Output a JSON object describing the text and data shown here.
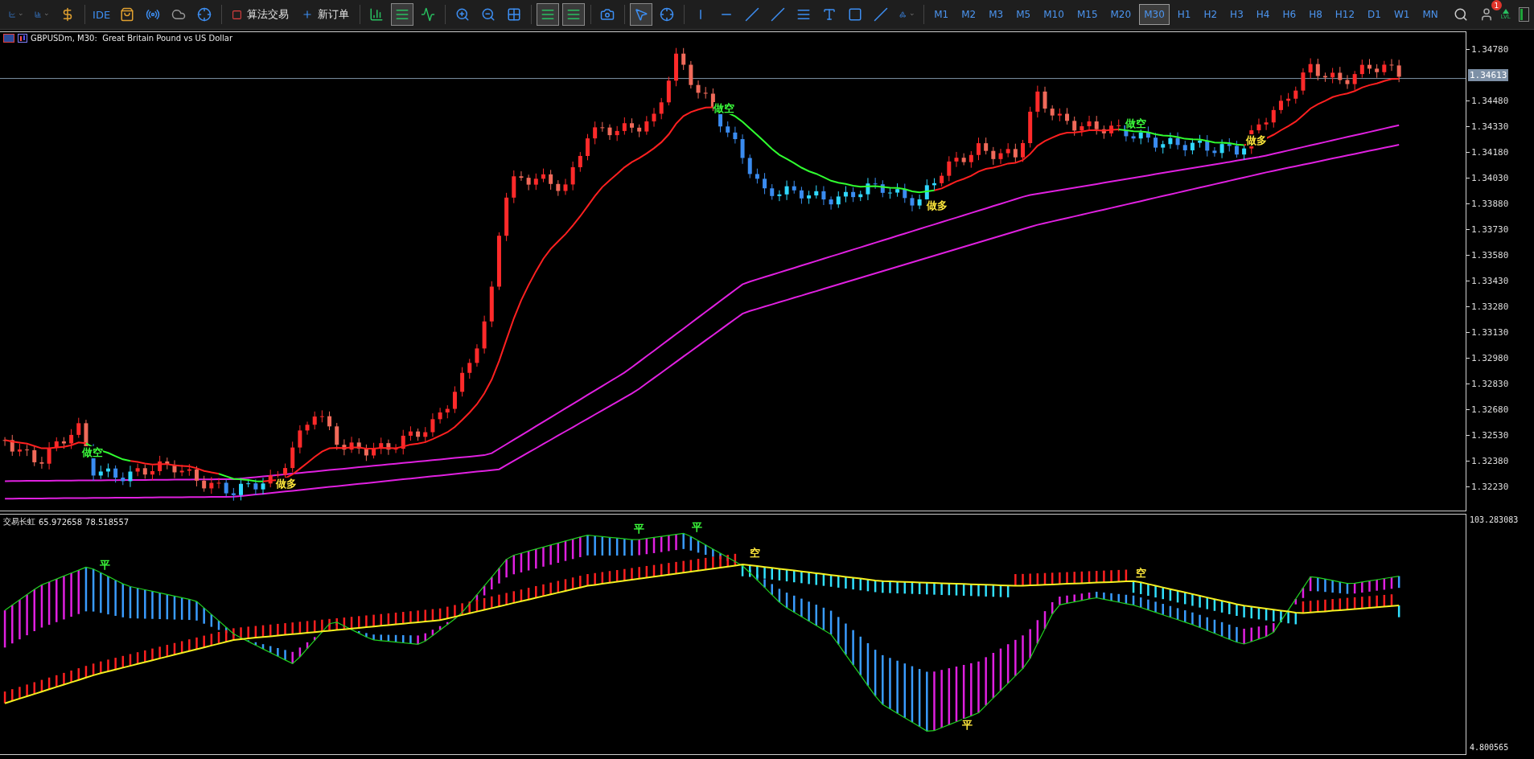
{
  "toolbar": {
    "ide": "IDE",
    "algo_trading": "算法交易",
    "new_order": "新订单",
    "timeframes": [
      {
        "label": "M1",
        "selected": false
      },
      {
        "label": "M2",
        "selected": false
      },
      {
        "label": "M3",
        "selected": false
      },
      {
        "label": "M5",
        "selected": false
      },
      {
        "label": "M10",
        "selected": false
      },
      {
        "label": "M15",
        "selected": false
      },
      {
        "label": "M20",
        "selected": false
      },
      {
        "label": "M30",
        "selected": true
      },
      {
        "label": "H1",
        "selected": false
      },
      {
        "label": "H2",
        "selected": false
      },
      {
        "label": "H3",
        "selected": false
      },
      {
        "label": "H4",
        "selected": false
      },
      {
        "label": "H6",
        "selected": false
      },
      {
        "label": "H8",
        "selected": false
      },
      {
        "label": "H12",
        "selected": false
      },
      {
        "label": "D1",
        "selected": false
      },
      {
        "label": "W1",
        "selected": false
      },
      {
        "label": "MN",
        "selected": false
      }
    ],
    "notification_count": "1",
    "signal_label": "LVL"
  },
  "chart": {
    "title": "GBPUSDm, M30:  Great Britain Pound vs US Dollar",
    "current_price": "1.34613",
    "price_ticks": [
      "1.34780",
      "1.34480",
      "1.34330",
      "1.34180",
      "1.34030",
      "1.33880",
      "1.33730",
      "1.33580",
      "1.33430",
      "1.33280",
      "1.33130",
      "1.32980",
      "1.32830",
      "1.32680",
      "1.32530",
      "1.32380",
      "1.32230"
    ],
    "signals": [
      {
        "text": "做空",
        "color": "#3cff3c"
      },
      {
        "text": "做多",
        "color": "#ffe83c"
      },
      {
        "text": "做空",
        "color": "#3cff3c"
      },
      {
        "text": "做多",
        "color": "#ffe83c"
      },
      {
        "text": "做空",
        "color": "#3cff3c"
      },
      {
        "text": "做多",
        "color": "#ffe83c"
      }
    ]
  },
  "indicator": {
    "name": "交易长虹",
    "values": [
      "65.972658",
      "78.518557"
    ],
    "axis_max": "103.283083",
    "axis_min": "4.800565",
    "marks": [
      {
        "text": "平",
        "color": "#3cff3c"
      },
      {
        "text": "平",
        "color": "#3cff3c"
      },
      {
        "text": "平",
        "color": "#3cff3c"
      },
      {
        "text": "空",
        "color": "#ffe83c"
      },
      {
        "text": "平",
        "color": "#ffe83c"
      },
      {
        "text": "空",
        "color": "#ffe83c"
      }
    ]
  }
}
